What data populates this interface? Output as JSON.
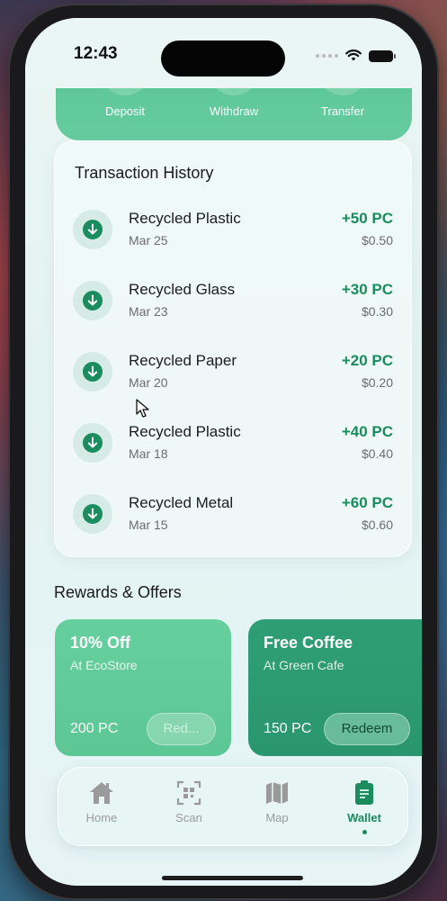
{
  "status": {
    "time": "12:43"
  },
  "actions": [
    {
      "label": "Deposit"
    },
    {
      "label": "Withdraw"
    },
    {
      "label": "Transfer"
    }
  ],
  "history": {
    "title": "Transaction History",
    "items": [
      {
        "name": "Recycled Plastic",
        "date": "Mar 25",
        "points": "+50 PC",
        "usd": "$0.50"
      },
      {
        "name": "Recycled Glass",
        "date": "Mar 23",
        "points": "+30 PC",
        "usd": "$0.30"
      },
      {
        "name": "Recycled Paper",
        "date": "Mar 20",
        "points": "+20 PC",
        "usd": "$0.20"
      },
      {
        "name": "Recycled Plastic",
        "date": "Mar 18",
        "points": "+40 PC",
        "usd": "$0.40"
      },
      {
        "name": "Recycled Metal",
        "date": "Mar 15",
        "points": "+60 PC",
        "usd": "$0.60"
      }
    ]
  },
  "rewards": {
    "title": "Rewards & Offers",
    "offers": [
      {
        "title": "10% Off",
        "subtitle": "At EcoStore",
        "cost": "200 PC",
        "button": "Red..."
      },
      {
        "title": "Free Coffee",
        "subtitle": "At Green Cafe",
        "cost": "150 PC",
        "button": "Redeem"
      }
    ]
  },
  "tabs": [
    {
      "label": "Home",
      "icon": "home-icon"
    },
    {
      "label": "Scan",
      "icon": "qr-scan-icon"
    },
    {
      "label": "Map",
      "icon": "map-icon"
    },
    {
      "label": "Wallet",
      "icon": "wallet-icon",
      "active": true
    }
  ],
  "colors": {
    "accent": "#1a8c5e",
    "card_green": "#66cc9f",
    "card_dark_green": "#2f9e76"
  }
}
